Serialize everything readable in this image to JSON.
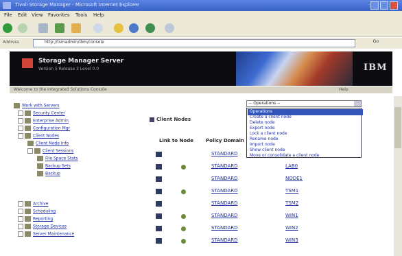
{
  "window": {
    "title": "Tivoli Storage Manager - Microsoft Internet Explorer"
  },
  "menu": [
    "File",
    "Edit",
    "View",
    "Favorites",
    "Tools",
    "Help"
  ],
  "address": {
    "label": "Address",
    "value": "http://tsmadmin/ibm/console",
    "go_label": "Go"
  },
  "header": {
    "title": "Storage Manager Server",
    "subtitle": "Version 5 Release 3 Level 0.0",
    "logo": "IBM"
  },
  "strip": {
    "text": "Welcome to the Integrated Solutions Console",
    "help": "Help"
  },
  "tree": [
    "Work with Servers",
    "Security Center",
    "Enterprise Admin",
    "Configuration Mgr",
    "Client Nodes",
    "Client Node Info",
    "Client Sessions",
    "File Space Stats",
    "Backup Sets",
    "Backup",
    "Archive",
    "Scheduling",
    "Reporting",
    "Storage Devices",
    "Server Maintenance"
  ],
  "content": {
    "title": "Client Nodes"
  },
  "columns": {
    "link": "Link to Node",
    "policy": "Policy Domain"
  },
  "dropdown": {
    "selected": "-- Operations --",
    "options": [
      "Operations",
      "Create a client node",
      "Delete node",
      "Export node",
      "Lock a client node",
      "Rename node",
      "Import node",
      "Show client node",
      "Move or consolidate a client node"
    ]
  },
  "rows": [
    {
      "domain": "STANDARD",
      "node": ""
    },
    {
      "domain": "STANDARD",
      "node": "LAB0"
    },
    {
      "domain": "STANDARD",
      "node": "NODE1"
    },
    {
      "domain": "STANDARD",
      "node": "TSM1"
    },
    {
      "domain": "STANDARD",
      "node": "TSM2"
    },
    {
      "domain": "STANDARD",
      "node": "WIN1"
    },
    {
      "domain": "STANDARD",
      "node": "WIN2"
    },
    {
      "domain": "STANDARD",
      "node": "WIN3"
    }
  ],
  "colors": {
    "accent": "#3155b8",
    "header_bg": "#0c0c10",
    "link": "#1e2ea0"
  }
}
